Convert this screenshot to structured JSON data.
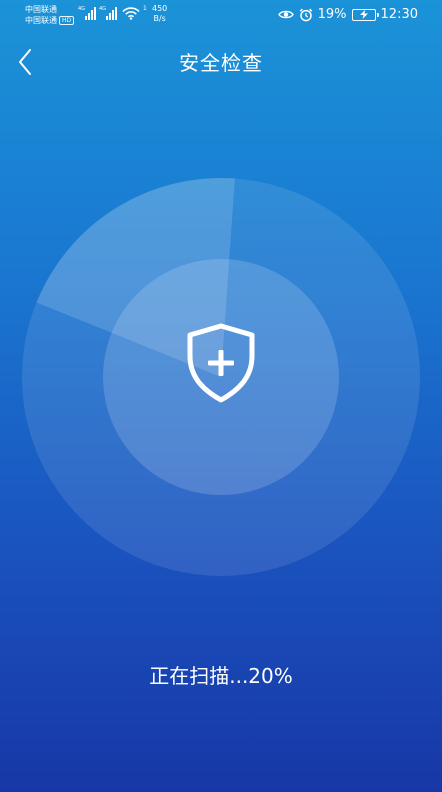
{
  "status_bar": {
    "carrier_1": "中国联通",
    "carrier_2": "中国联通",
    "hd_badge": "HD",
    "network_1": "4G",
    "network_2": "4G",
    "wifi_superscript": "1",
    "speed_value": "450",
    "speed_unit": "B/s",
    "battery_percent": "19%",
    "time": "12:30"
  },
  "header": {
    "title": "安全检查"
  },
  "scan": {
    "progress_percent": 20,
    "status_text": "正在扫描...20%"
  },
  "colors": {
    "background_top": "#1b93d8",
    "background_bottom": "#1737a6",
    "foreground": "#ffffff"
  },
  "icons": {
    "back": "chevron-left-icon",
    "shield": "shield-plus-icon",
    "eye": "eye-icon",
    "alarm": "alarm-icon",
    "battery": "battery-charging-icon",
    "wifi": "wifi-icon"
  }
}
